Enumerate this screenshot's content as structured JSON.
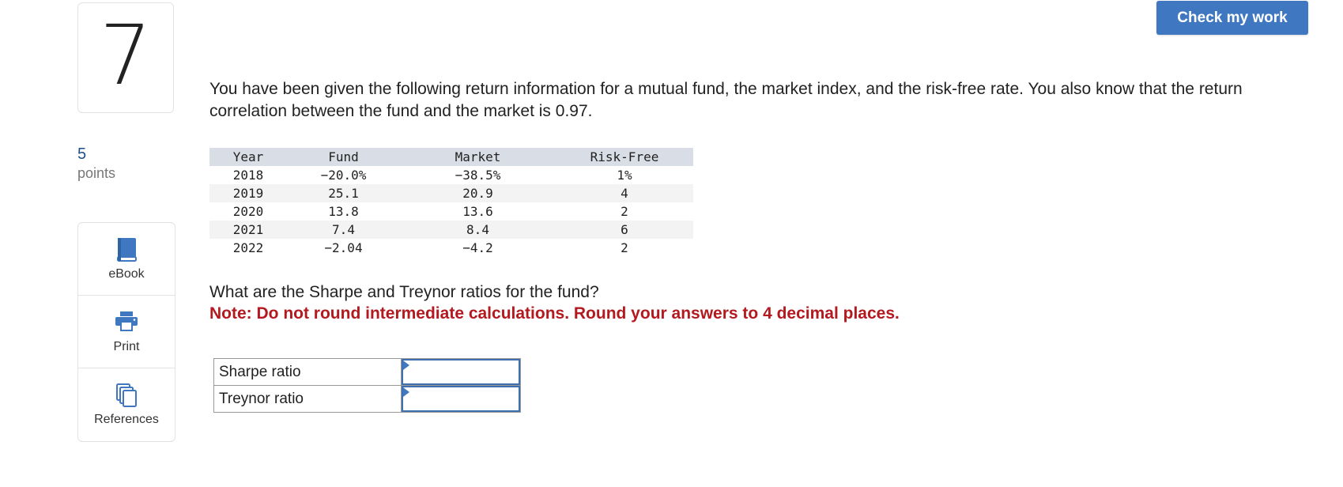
{
  "question": {
    "number": "7",
    "points_value": "5",
    "points_label": "points",
    "text": "You have been given the following return information for a mutual fund, the market index, and the risk-free rate. You also know that the return correlation between the fund and the market is 0.97.",
    "ask": "What are the Sharpe and Treynor ratios for the fund?",
    "note": "Note: Do not round intermediate calculations. Round your answers to 4 decimal places."
  },
  "header": {
    "check_label": "Check my work"
  },
  "tools": [
    {
      "label": "eBook",
      "icon": "book-icon"
    },
    {
      "label": "Print",
      "icon": "printer-icon"
    },
    {
      "label": "References",
      "icon": "copy-icon"
    }
  ],
  "returns_table": {
    "headers": [
      "Year",
      "Fund",
      "Market",
      "Risk-Free"
    ],
    "rows": [
      [
        "2018",
        "−20.0%",
        "−38.5%",
        "1%"
      ],
      [
        "2019",
        "25.1",
        "20.9",
        "4"
      ],
      [
        "2020",
        "13.8",
        "13.6",
        "2"
      ],
      [
        "2021",
        "7.4",
        "8.4",
        "6"
      ],
      [
        "2022",
        "−2.04",
        "−4.2",
        "2"
      ]
    ]
  },
  "answers": [
    {
      "label": "Sharpe ratio",
      "value": ""
    },
    {
      "label": "Treynor ratio",
      "value": ""
    }
  ],
  "colors": {
    "accent": "#3f78c1",
    "note_red": "#b3191e",
    "points_blue": "#1f4f8b",
    "table_header": "#d9dde6"
  }
}
